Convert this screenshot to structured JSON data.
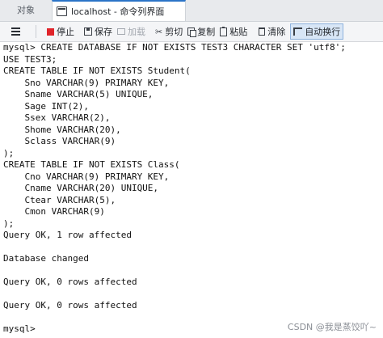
{
  "tabs": [
    {
      "label": "对象"
    },
    {
      "label": "localhost - 命令列界面"
    }
  ],
  "toolbar": {
    "stop_label": "停止",
    "save_label": "保存",
    "load_label": "加载",
    "cut_label": "剪切",
    "copy_label": "复制",
    "paste_label": "粘贴",
    "clear_label": "清除",
    "wrap_label": "自动换行"
  },
  "console": {
    "lines": [
      "mysql> CREATE DATABASE IF NOT EXISTS TEST3 CHARACTER SET 'utf8';",
      "USE TEST3;",
      "CREATE TABLE IF NOT EXISTS Student(",
      "    Sno VARCHAR(9) PRIMARY KEY,",
      "    Sname VARCHAR(5) UNIQUE,",
      "    Sage INT(2),",
      "    Ssex VARCHAR(2),",
      "    Shome VARCHAR(20),",
      "    Sclass VARCHAR(9)",
      ");",
      "CREATE TABLE IF NOT EXISTS Class(",
      "    Cno VARCHAR(9) PRIMARY KEY,",
      "    Cname VARCHAR(20) UNIQUE,",
      "    Ctear VARCHAR(5),",
      "    Cmon VARCHAR(9)",
      ");",
      "Query OK, 1 row affected",
      "",
      "Database changed",
      "",
      "Query OK, 0 rows affected",
      "",
      "Query OK, 0 rows affected",
      "",
      "mysql> "
    ]
  },
  "watermark": "CSDN @我是蒸饺吖~",
  "colors": {
    "stop_icon": "#e0242a",
    "active_tab_accent": "#2b74c7",
    "pressed_button_bg": "#d8e6f6"
  }
}
